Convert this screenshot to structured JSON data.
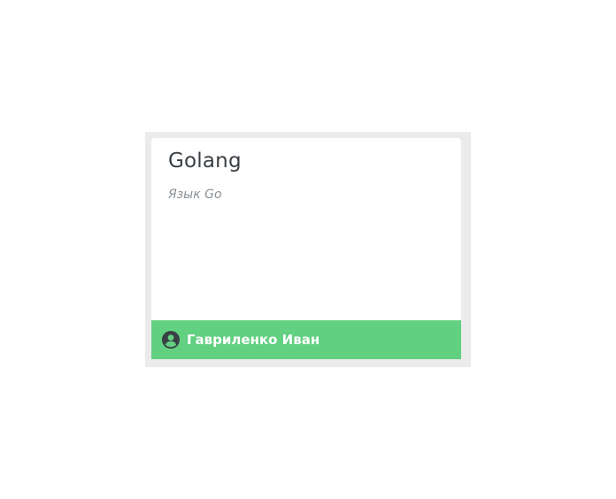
{
  "card": {
    "title": "Golang",
    "subtitle": "Язык Go",
    "footer": {
      "author_icon": "user-circle-icon",
      "author_name": "Гавриленко Иван",
      "color": "#62d081"
    }
  },
  "colors": {
    "frame": "#ebebeb",
    "title": "#3a3f44",
    "subtitle": "#8a9096",
    "icon": "#3a3f44"
  }
}
